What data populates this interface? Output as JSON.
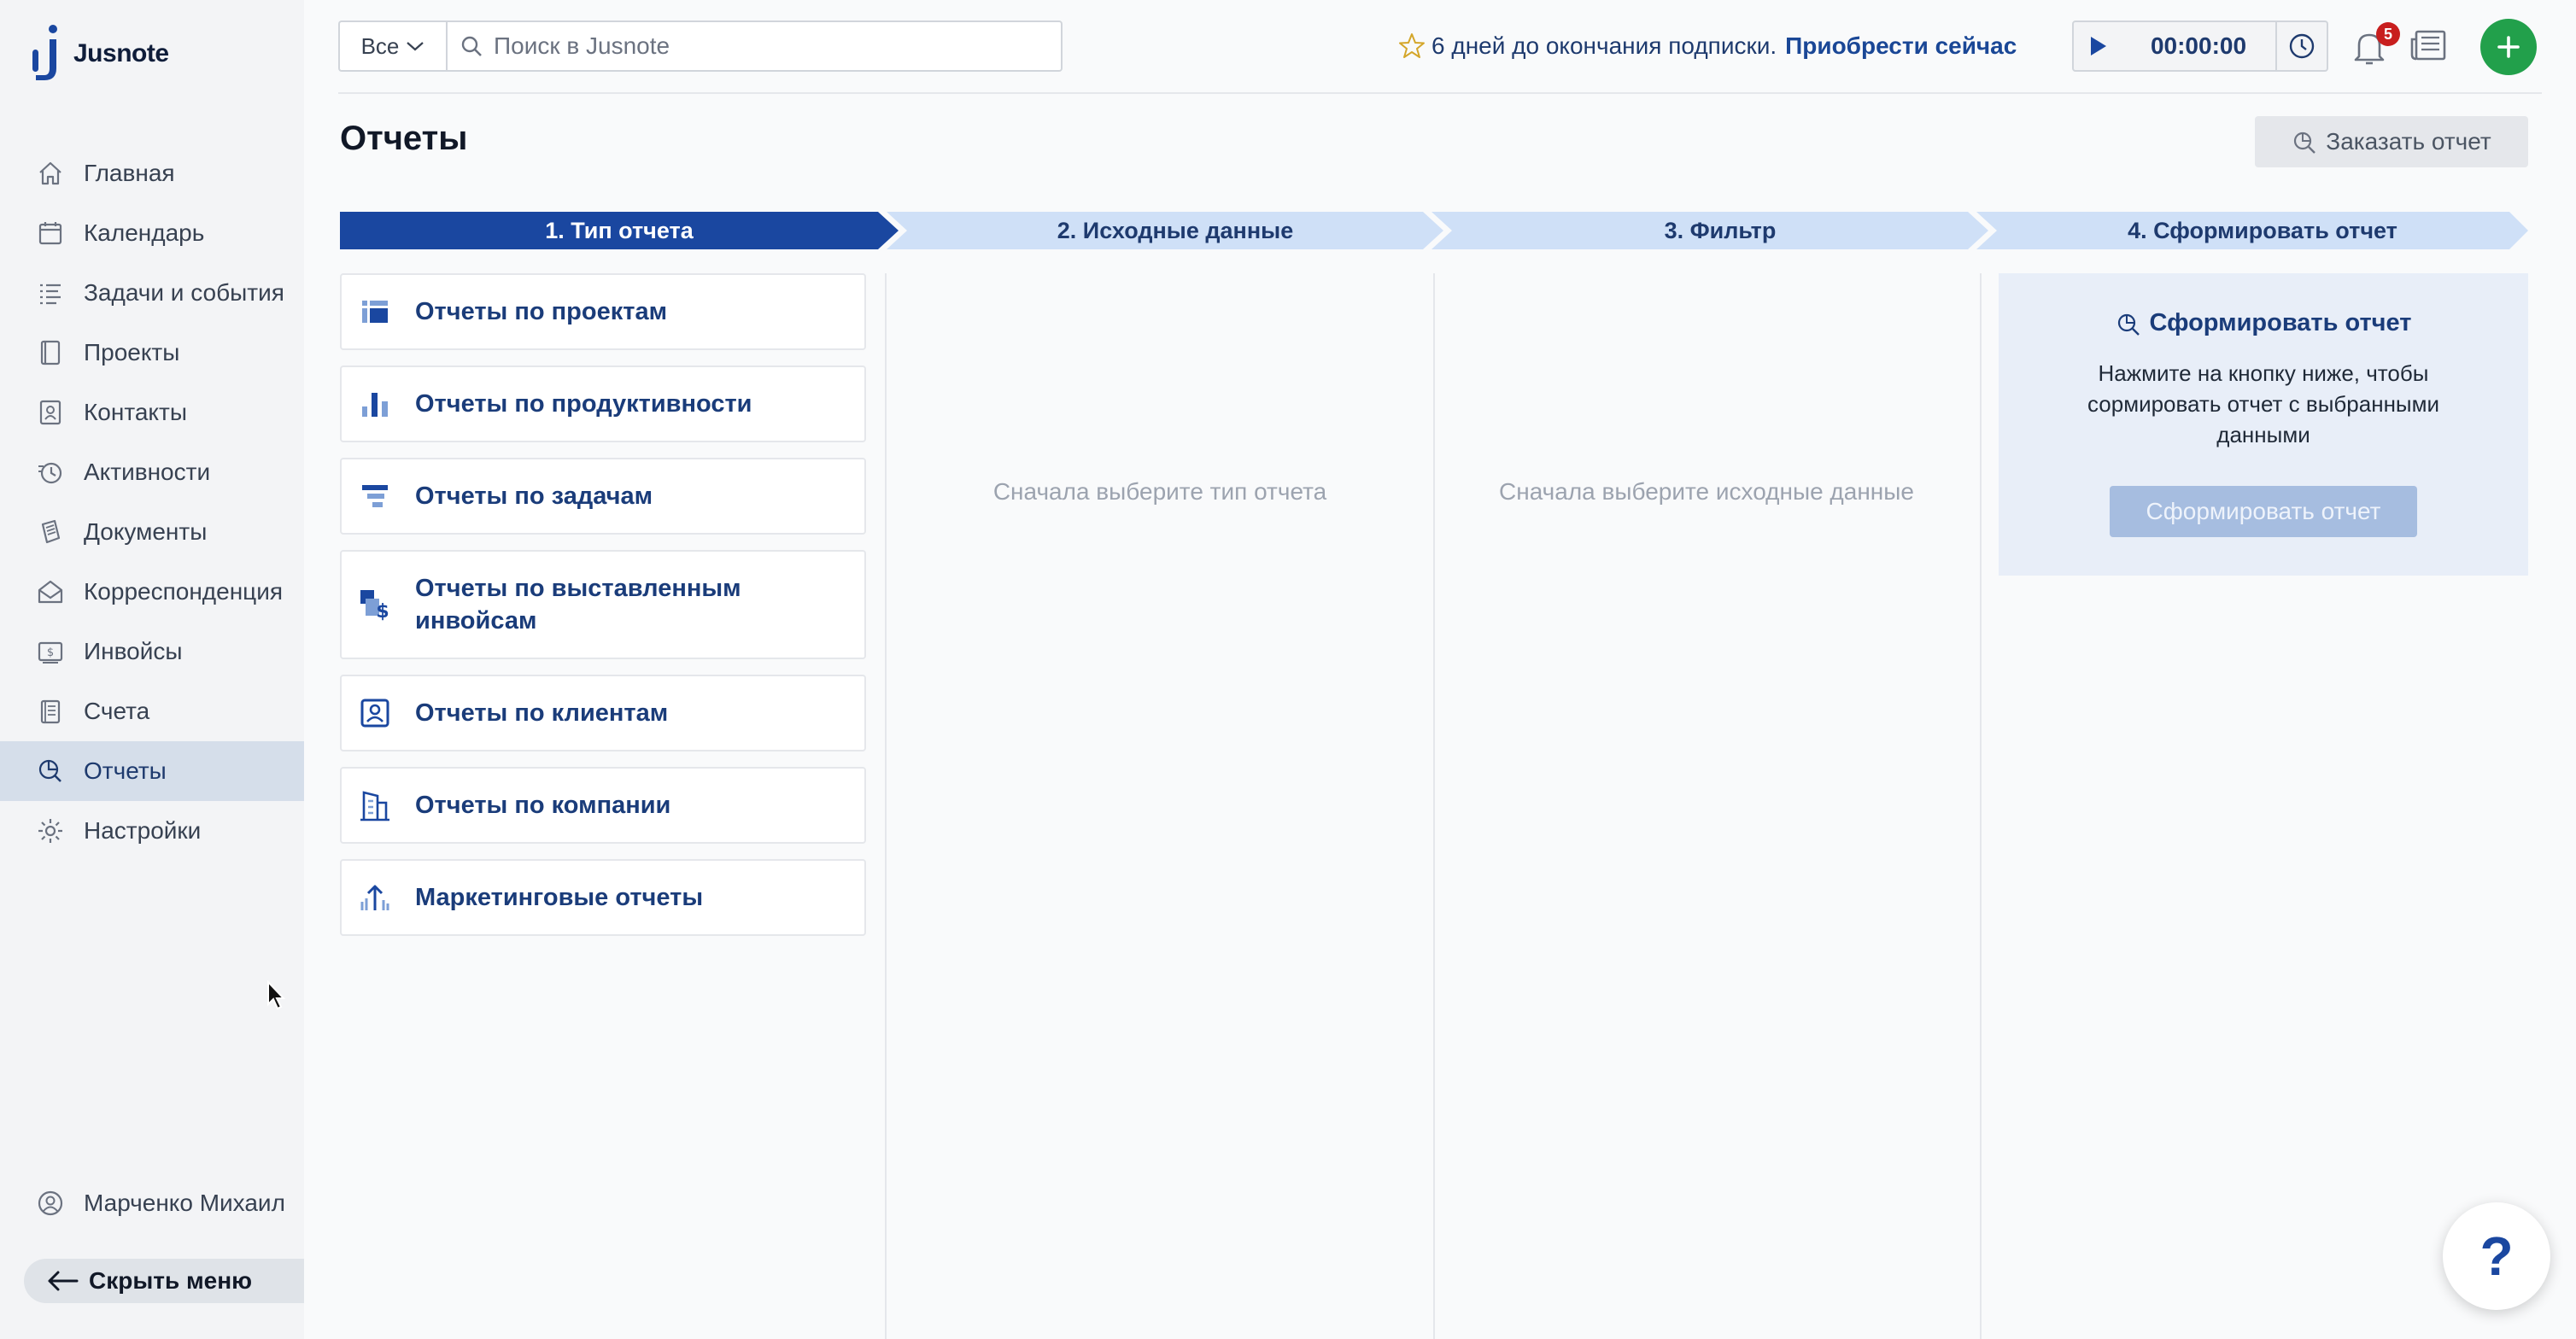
{
  "app": {
    "name": "Jusnote"
  },
  "sidebar": {
    "items": [
      {
        "label": "Главная",
        "icon": "home-icon"
      },
      {
        "label": "Календарь",
        "icon": "calendar-icon"
      },
      {
        "label": "Задачи и события",
        "icon": "tasks-icon"
      },
      {
        "label": "Проекты",
        "icon": "projects-icon"
      },
      {
        "label": "Контакты",
        "icon": "contacts-icon"
      },
      {
        "label": "Активности",
        "icon": "activities-icon"
      },
      {
        "label": "Документы",
        "icon": "documents-icon"
      },
      {
        "label": "Корреспонденция",
        "icon": "correspondence-icon"
      },
      {
        "label": "Инвойсы",
        "icon": "invoices-icon"
      },
      {
        "label": "Счета",
        "icon": "accounts-icon"
      },
      {
        "label": "Отчеты",
        "icon": "reports-icon",
        "active": true
      },
      {
        "label": "Настройки",
        "icon": "settings-icon"
      }
    ],
    "user_name": "Марченко Михаил",
    "hide_menu_label": "Скрыть меню"
  },
  "topbar": {
    "scope_label": "Все",
    "search_placeholder": "Поиск в Jusnote",
    "subscription_text": "6 дней до окончания подписки.",
    "subscription_link": "Приобрести сейчас",
    "timer_value": "00:00:00",
    "notification_count": "5"
  },
  "page": {
    "title": "Отчеты",
    "order_report_label": "Заказать отчет"
  },
  "stepper": {
    "steps": [
      {
        "label": "1. Тип отчета",
        "active": true
      },
      {
        "label": "2. Исходные данные",
        "active": false
      },
      {
        "label": "3. Фильтр",
        "active": false
      },
      {
        "label": "4. Сформировать отчет",
        "active": false
      }
    ]
  },
  "report_types": [
    {
      "label": "Отчеты по проектам",
      "icon": "projects-report-icon"
    },
    {
      "label": "Отчеты по продуктивности",
      "icon": "bar-chart-icon"
    },
    {
      "label": "Отчеты по задачам",
      "icon": "tasks-report-icon"
    },
    {
      "label": "Отчеты по выставленным инвойсам",
      "icon": "invoice-dollar-icon"
    },
    {
      "label": "Отчеты по клиентам",
      "icon": "client-icon"
    },
    {
      "label": "Отчеты по компании",
      "icon": "building-icon"
    },
    {
      "label": "Маркетинговые отчеты",
      "icon": "marketing-icon"
    }
  ],
  "columns": {
    "source_placeholder": "Сначала выберите тип отчета",
    "filter_placeholder": "Сначала выберите исходные данные"
  },
  "generate": {
    "title": "Сформировать отчет",
    "description": "Нажмите на кнопку ниже, чтобы сормировать отчет с выбранными данными",
    "button_label": "Сформировать отчет"
  },
  "help": {
    "label": "?"
  },
  "colors": {
    "accent": "#1a47a0",
    "step_active": "#1a47a0",
    "step_inactive": "#cfe0f7",
    "add_button": "#22a04b",
    "badge": "#c81e1e",
    "sidebar_active": "#d5deea"
  }
}
